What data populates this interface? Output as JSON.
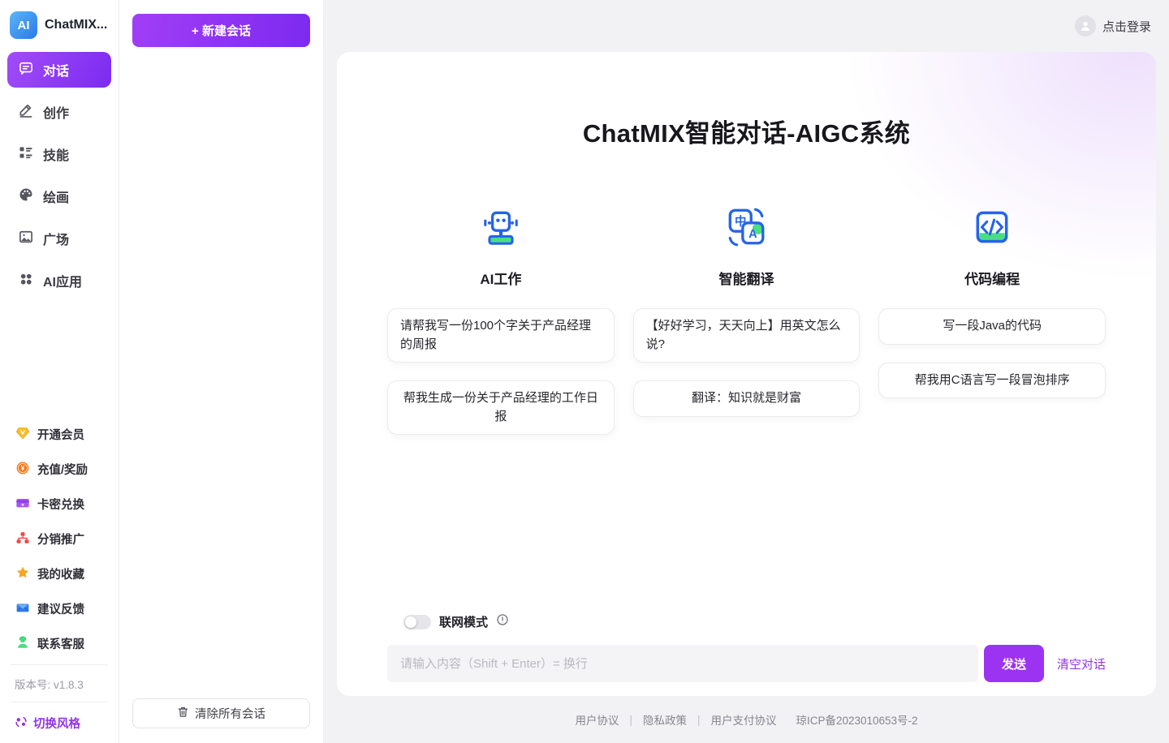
{
  "app": {
    "logo_text": "AI",
    "title": "ChatMIX...",
    "login": "点击登录"
  },
  "sidebar": {
    "menu": [
      {
        "label": "对话",
        "icon": "chat-icon",
        "active": true
      },
      {
        "label": "创作",
        "icon": "pencil-icon",
        "active": false
      },
      {
        "label": "技能",
        "icon": "skills-icon",
        "active": false
      },
      {
        "label": "绘画",
        "icon": "palette-icon",
        "active": false
      },
      {
        "label": "广场",
        "icon": "gallery-icon",
        "active": false
      },
      {
        "label": "AI应用",
        "icon": "apps-icon",
        "active": false
      }
    ],
    "secondary": [
      {
        "label": "开通会员",
        "icon": "vip-diamond-icon"
      },
      {
        "label": "充值/奖励",
        "icon": "coin-icon"
      },
      {
        "label": "卡密兑换",
        "icon": "card-icon"
      },
      {
        "label": "分销推广",
        "icon": "network-icon"
      },
      {
        "label": "我的收藏",
        "icon": "star-icon"
      },
      {
        "label": "建议反馈",
        "icon": "feedback-mail-icon"
      },
      {
        "label": "联系客服",
        "icon": "support-agent-icon"
      }
    ],
    "version": "版本号: v1.8.3",
    "switch_style": "切换风格"
  },
  "conversation_panel": {
    "new_session": "+ 新建会话",
    "clear_all": "清除所有会话"
  },
  "main": {
    "title": "ChatMIX智能对话-AIGC系统",
    "features": [
      {
        "label": "AI工作",
        "icon": "robot-icon",
        "chips": [
          "请帮我写一份100个字关于产品经理的周报",
          "帮我生成一份关于产品经理的工作日报"
        ]
      },
      {
        "label": "智能翻译",
        "icon": "translate-icon",
        "chips": [
          "【好好学习，天天向上】用英文怎么说?",
          "翻译：知识就是财富"
        ]
      },
      {
        "label": "代码编程",
        "icon": "code-icon",
        "chips": [
          "写一段Java的代码",
          "帮我用C语言写一段冒泡排序"
        ]
      }
    ],
    "network_mode": "联网模式",
    "network_mode_on": false,
    "input_placeholder": "请输入内容（Shift + Enter）= 换行",
    "send": "发送",
    "clear_chat": "清空对话"
  },
  "footer": {
    "links": [
      "用户协议",
      "隐私政策",
      "用户支付协议"
    ],
    "separator": "|",
    "icp": "琼ICP备2023010653号-2"
  },
  "colors": {
    "primary_purple": "#9333ea",
    "purple_gradient_start": "#a24cf8",
    "purple_gradient_end": "#7b2bf0",
    "logo_blue_start": "#5cb5f5",
    "logo_blue_end": "#2979ec",
    "feature_icon_blue": "#2563eb",
    "feature_icon_green": "#4ade80",
    "background_gray": "#f2f2f5"
  }
}
